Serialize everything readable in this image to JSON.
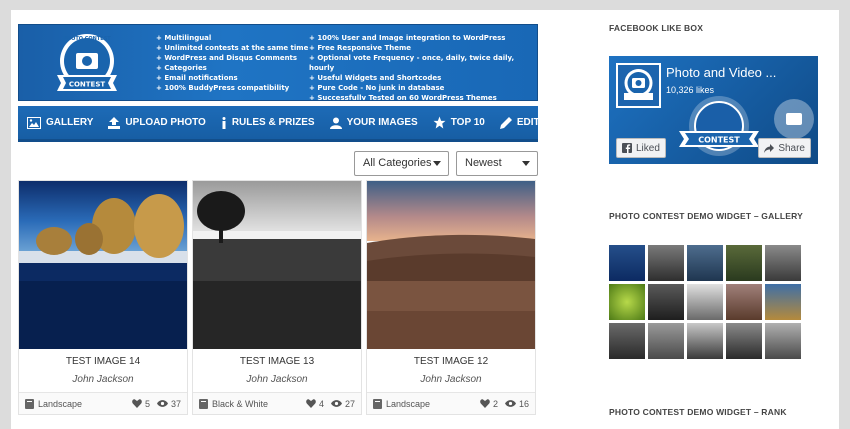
{
  "banner": {
    "logo_text": "PHOTO CONTEST",
    "logo_ribbon": "CONTEST",
    "features_left": [
      "Multilingual",
      "Unlimited contests at the same time",
      "WordPress and Disqus Comments",
      "Categories",
      "Email notifications",
      "100% BuddyPress compatibility"
    ],
    "features_right": [
      "100% User and Image integration to WordPress",
      "Free Responsive Theme",
      "Optional vote Frequency - once, daily, twice daily, hourly",
      "Useful Widgets and Shortcodes",
      "Pure Code - No junk in database",
      "Successfully Tested on 60 WordPress Themes"
    ]
  },
  "nav": {
    "gallery": "GALLERY",
    "upload": "UPLOAD PHOTO",
    "rules": "RULES & PRIZES",
    "your_images": "YOUR IMAGES",
    "top10": "TOP 10",
    "edit": "EDIT"
  },
  "filters": {
    "category": "All Categories",
    "sort": "Newest"
  },
  "cards": [
    {
      "title": "TEST IMAGE 14",
      "author": "John Jackson",
      "category": "Landscape",
      "likes": "5",
      "views": "37"
    },
    {
      "title": "TEST IMAGE 13",
      "author": "John Jackson",
      "category": "Black & White",
      "likes": "4",
      "views": "27"
    },
    {
      "title": "TEST IMAGE 12",
      "author": "John Jackson",
      "category": "Landscape",
      "likes": "2",
      "views": "16"
    }
  ],
  "sidebar": {
    "fb_heading": "FACEBOOK LIKE BOX",
    "fb_page_name": "Photo and Video ...",
    "fb_likes": "10,326 likes",
    "fb_liked": "Liked",
    "fb_share": "Share",
    "gallery_heading": "PHOTO CONTEST DEMO WIDGET – GALLERY",
    "rank_heading": "PHOTO CONTEST DEMO WIDGET – RANK"
  },
  "colors": {
    "nav_blue": "#1a64ad",
    "banner_blue": "#1f74c4",
    "page_bg": "#dcdcdc"
  }
}
